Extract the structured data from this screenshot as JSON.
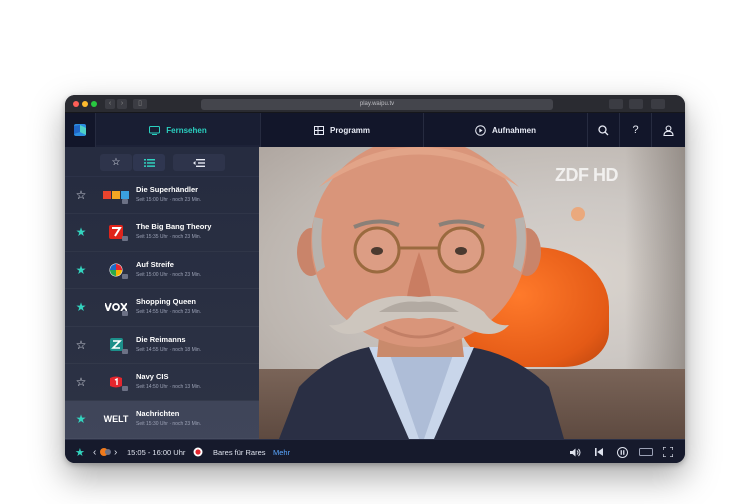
{
  "browser": {
    "url": "play.waipu.tv"
  },
  "nav": {
    "tabs": [
      {
        "label": "Fernsehen",
        "icon": "tv-icon",
        "active": true
      },
      {
        "label": "Programm",
        "icon": "grid-icon",
        "active": false
      },
      {
        "label": "Aufnahmen",
        "icon": "play-circle-icon",
        "active": false
      }
    ],
    "icons": [
      "search-icon",
      "help-icon",
      "user-icon"
    ],
    "help_glyph": "?"
  },
  "sidebar": {
    "filters": [
      {
        "icon": "star-icon",
        "active": false
      },
      {
        "icon": "list-icon",
        "active": true
      },
      {
        "icon": "sort-list-icon",
        "active": false
      }
    ],
    "channels": [
      {
        "logo": "RTL",
        "title": "Die Superhändler",
        "time": "Seit 15:00 Uhr · noch 23 Min.",
        "favorite": false
      },
      {
        "logo": "Pro7",
        "title": "The Big Bang Theory",
        "time": "Seit 15:35 Uhr · noch 23 Min.",
        "favorite": true
      },
      {
        "logo": "Sat.1",
        "title": "Auf Streife",
        "time": "Seit 15:00 Uhr · noch 23 Min.",
        "favorite": true
      },
      {
        "logo": "VOX",
        "title": "Shopping Queen",
        "time": "Seit 14:55 Uhr · noch 23 Min.",
        "favorite": true
      },
      {
        "logo": "RTLZWEI",
        "title": "Die Reimanns",
        "time": "Seit 14:55 Uhr · noch 18 Min.",
        "favorite": false
      },
      {
        "logo": "kabel eins",
        "title": "Navy CIS",
        "time": "Seit 14:50 Uhr · noch 13 Min.",
        "favorite": false
      },
      {
        "logo": "WELT",
        "title": "Nachrichten",
        "time": "Seit 15:30 Uhr · noch 23 Min.",
        "favorite": true,
        "active": true
      }
    ]
  },
  "video": {
    "watermark": "ZDF HD"
  },
  "player": {
    "time_range": "15:05 - 16:00 Uhr",
    "show_title": "Bares für Rares",
    "more_label": "Mehr"
  },
  "colors": {
    "accent": "#33d4bf",
    "background": "#1b2033",
    "link": "#5aa7ff"
  }
}
